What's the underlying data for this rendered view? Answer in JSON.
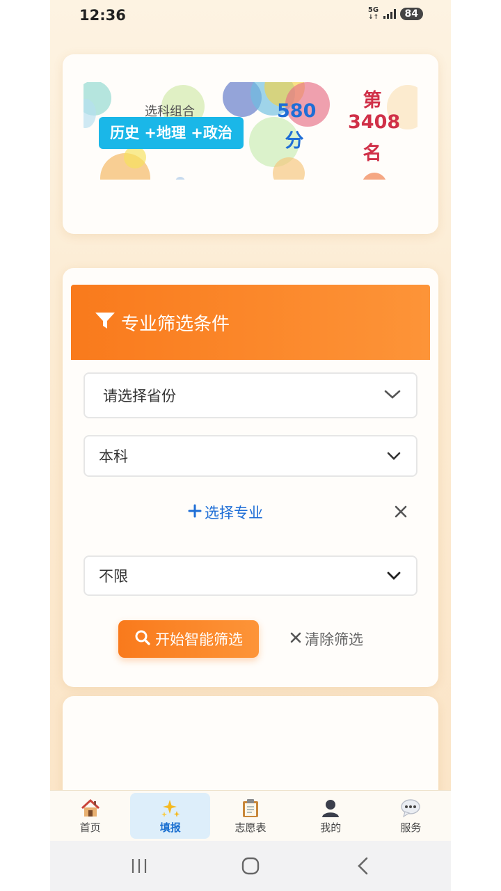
{
  "status_bar": {
    "time": "12:36",
    "network": "5G",
    "battery": "84"
  },
  "score_card": {
    "combo_label": "选科组合",
    "combo_value": "历史 +地理 +政治",
    "score_value": "580",
    "score_unit": "分",
    "rank_prefix": "第",
    "rank_value": "3408",
    "rank_suffix": "名"
  },
  "filter_panel": {
    "title": "专业筛选条件",
    "province_select": {
      "value": "请选择省份"
    },
    "level_select": {
      "value": "本科"
    },
    "choose_major_label": "选择专业",
    "limit_select": {
      "value": "不限"
    },
    "start_button": "开始智能筛选",
    "clear_button": "清除筛选"
  },
  "tabbar": {
    "items": [
      {
        "label": "首页",
        "icon": "home-icon"
      },
      {
        "label": "填报",
        "icon": "sparkles-icon",
        "active": true
      },
      {
        "label": "志愿表",
        "icon": "clipboard-icon"
      },
      {
        "label": "我的",
        "icon": "user-icon"
      },
      {
        "label": "服务",
        "icon": "chat-bubble-icon"
      }
    ]
  },
  "colors": {
    "accent_orange": "#f97a1c",
    "accent_blue": "#1f6ed6",
    "rank_red": "#d03048",
    "combo_cyan": "#1ab7e8"
  }
}
